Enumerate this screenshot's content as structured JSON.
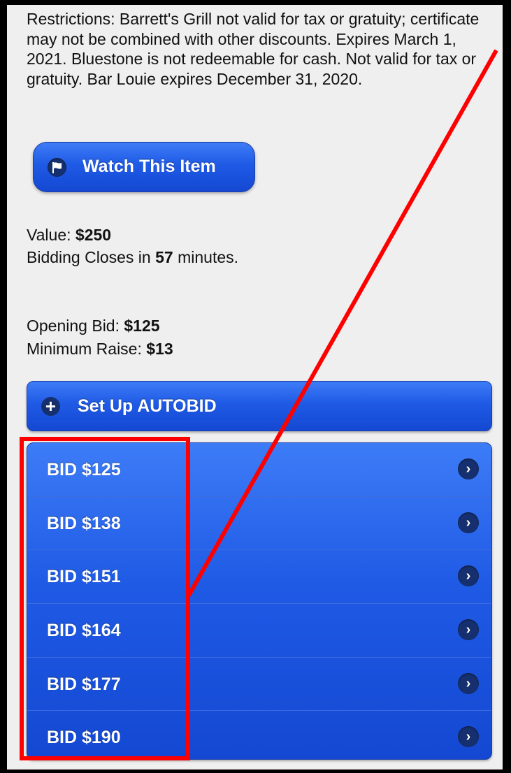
{
  "restrictions_text": "Restrictions: Barrett's Grill not valid for tax or gratuity; certificate may not be combined with other discounts. Expires March 1, 2021. Bluestone is not redeemable for cash. Not valid for tax or gratuity. Bar Louie expires December 31, 2020.",
  "watch_button": {
    "label": "Watch This Item",
    "icon": "flag-icon"
  },
  "value": {
    "label": "Value:",
    "amount": "$250"
  },
  "closing": {
    "prefix": "Bidding Closes in",
    "minutes": "57",
    "suffix": "minutes."
  },
  "opening_bid": {
    "label": "Opening Bid:",
    "amount": "$125"
  },
  "minimum_raise": {
    "label": "Minimum Raise:",
    "amount": "$13"
  },
  "autobid_button": {
    "label": "Set Up AUTOBID",
    "icon": "plus-icon"
  },
  "bids": [
    {
      "label": "BID $125"
    },
    {
      "label": "BID $138"
    },
    {
      "label": "BID $151"
    },
    {
      "label": "BID $164"
    },
    {
      "label": "BID $177"
    },
    {
      "label": "BID $190"
    }
  ],
  "annotation_color": "#ff0000",
  "colors": {
    "button_blue": "#1f5ae5",
    "background": "#efefef"
  }
}
